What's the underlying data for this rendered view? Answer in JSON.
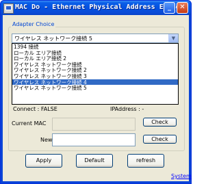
{
  "window": {
    "title": "MAC Do - Ethernet Physical Address Editer",
    "minimize": "_",
    "close": "✕"
  },
  "adapter": {
    "group_label": "Adapter Choice",
    "selected": "ワイヤレス ネットワーク接続 5",
    "options": [
      "1394 接続",
      "ローカル エリア接続",
      "ローカル エリア接続 2",
      "ワイヤレス ネットワーク接続",
      "ワイヤレス ネットワーク接続 2",
      "ワイヤレス ネットワーク接続 3",
      "ワイヤレス ネットワーク接続 4",
      "ワイヤレス ネットワーク接続 5"
    ],
    "highlighted_index": 6
  },
  "status": {
    "connect": "Connect : FALSE",
    "ip": "IPAddress : -"
  },
  "current_mac": {
    "label": "Current MAC",
    "value": "",
    "check": "Check"
  },
  "new_mac": {
    "label": "New MAC",
    "value": "",
    "check": "Check"
  },
  "buttons": {
    "apply": "Apply",
    "default": "Default",
    "refresh": "refresh"
  },
  "system_link": "System"
}
